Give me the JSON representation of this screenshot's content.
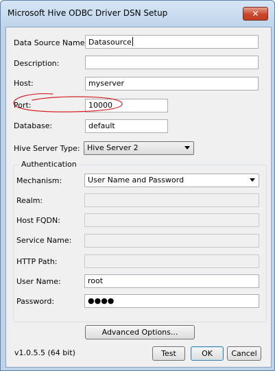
{
  "window": {
    "title": "Microsoft Hive ODBC Driver DSN Setup",
    "close_glyph": "✕"
  },
  "form": {
    "data_source_name": {
      "label": "Data Source Name:",
      "value": "Datasource"
    },
    "description": {
      "label": "Description:",
      "value": ""
    },
    "host": {
      "label": "Host:",
      "value": "myserver"
    },
    "port": {
      "label": "Port:",
      "value": "10000"
    },
    "database": {
      "label": "Database:",
      "value": "default"
    },
    "hive_server_type": {
      "label": "Hive Server Type:",
      "value": "Hive Server 2"
    }
  },
  "authentication": {
    "title": "Authentication",
    "mechanism": {
      "label": "Mechanism:",
      "value": "User Name and Password"
    },
    "realm": {
      "label": "Realm:",
      "value": ""
    },
    "host_fqdn": {
      "label": "Host FQDN:",
      "value": ""
    },
    "service_name": {
      "label": "Service Name:",
      "value": ""
    },
    "http_path": {
      "label": "HTTP Path:",
      "value": ""
    },
    "user_name": {
      "label": "User Name:",
      "value": "root"
    },
    "password": {
      "label": "Password:",
      "value": "●●●●"
    }
  },
  "buttons": {
    "advanced": "Advanced Options...",
    "test": "Test",
    "ok": "OK",
    "cancel": "Cancel"
  },
  "version": "v1.0.5.5 (64 bit)",
  "colors": {
    "annotation": "#d81f26",
    "titlebar": "#bfd4ea",
    "close_button": "#c9462c"
  }
}
